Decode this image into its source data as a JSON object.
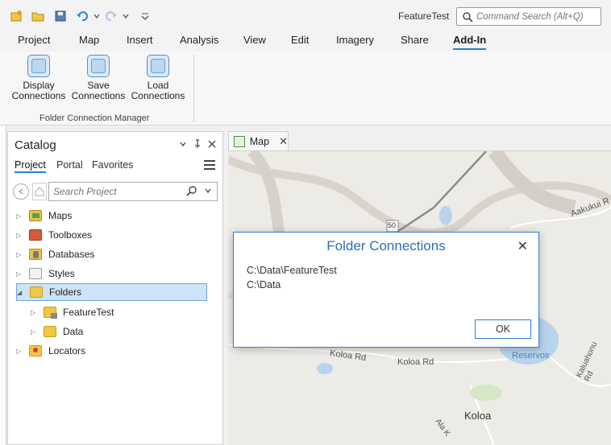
{
  "app": {
    "title": "FeatureTest"
  },
  "command_search": {
    "placeholder": "Command Search (Alt+Q)"
  },
  "ribbon": {
    "tabs": [
      "Project",
      "Map",
      "Insert",
      "Analysis",
      "View",
      "Edit",
      "Imagery",
      "Share",
      "Add-In"
    ],
    "active_tab": "Add-In",
    "buttons": [
      {
        "line1": "Display",
        "line2": "Connections"
      },
      {
        "line1": "Save",
        "line2": "Connections"
      },
      {
        "line1": "Load",
        "line2": "Connections"
      }
    ],
    "group_label": "Folder Connection Manager"
  },
  "catalog": {
    "title": "Catalog",
    "tabs": [
      "Project",
      "Portal",
      "Favorites"
    ],
    "search_placeholder": "Search Project",
    "tree": [
      {
        "label": "Maps",
        "icon": "maps-icon"
      },
      {
        "label": "Toolboxes",
        "icon": "toolbox-icon"
      },
      {
        "label": "Databases",
        "icon": "database-icon"
      },
      {
        "label": "Styles",
        "icon": "styles-icon"
      },
      {
        "label": "Folders",
        "icon": "folder-icon",
        "selected": true
      },
      {
        "label": "FeatureTest",
        "icon": "folder-home-icon"
      },
      {
        "label": "Data",
        "icon": "folder-icon"
      },
      {
        "label": "Locators",
        "icon": "locator-icon"
      }
    ]
  },
  "map": {
    "tab_label": "Map",
    "labels": [
      "Aakukui R",
      "Koloa Rd",
      "Koloa Rd",
      "Reservoir",
      "Koloa",
      "Kaluahonu Rd",
      "Ala K",
      "50"
    ]
  },
  "dialog": {
    "title": "Folder Connections",
    "lines": [
      "C:\\Data\\FeatureTest",
      "C:\\Data"
    ],
    "ok_label": "OK"
  },
  "colors": {
    "accent": "#2a7fd4",
    "dialog_title": "#2a6fb8",
    "selected": "#cde3f7"
  }
}
